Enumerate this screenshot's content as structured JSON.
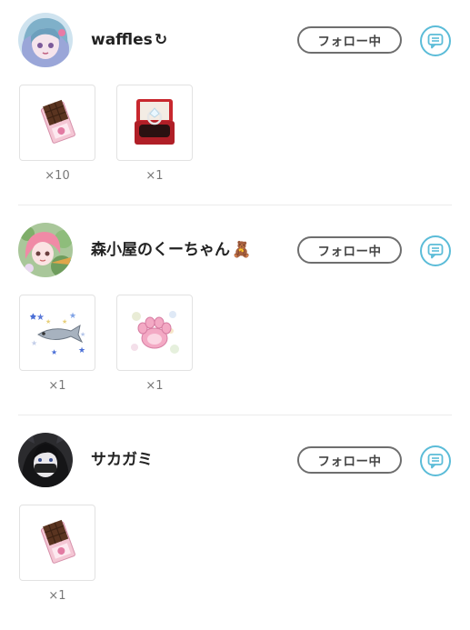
{
  "users": [
    {
      "name": "waffles",
      "name_suffix": "↻",
      "follow_label": "フォロー中",
      "gifts": [
        {
          "item": "chocolate-bar",
          "count": "×10"
        },
        {
          "item": "ring-box",
          "count": "×1"
        }
      ]
    },
    {
      "name": "森小屋のくーちゃん",
      "name_suffix": "🧸",
      "follow_label": "フォロー中",
      "gifts": [
        {
          "item": "fish-with-stars",
          "count": "×1"
        },
        {
          "item": "cat-paw",
          "count": "×1"
        }
      ]
    },
    {
      "name": "サカガミ",
      "name_suffix": "",
      "follow_label": "フォロー中",
      "gifts": [
        {
          "item": "chocolate-bar",
          "count": "×1"
        }
      ]
    }
  ],
  "colors": {
    "accent": "#5bbcd8",
    "button_border": "#6e6e6e",
    "divider": "#ececec"
  }
}
